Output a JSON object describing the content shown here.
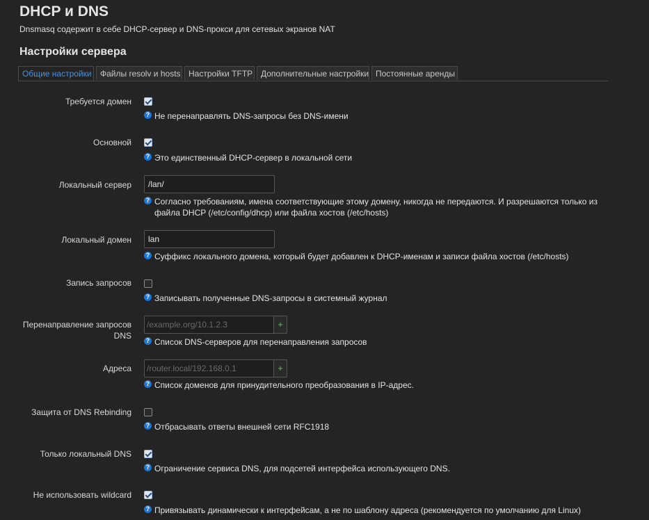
{
  "header": {
    "title": "DHCP и DNS",
    "description": "Dnsmasq содержит в себе DHCP-сервер и DNS-прокси для сетевых экранов NAT"
  },
  "section": {
    "title": "Настройки сервера"
  },
  "tabs": [
    {
      "label": "Общие настройки",
      "active": true
    },
    {
      "label": "Файлы resolv и hosts",
      "active": false
    },
    {
      "label": "Настройки TFTP",
      "active": false
    },
    {
      "label": "Дополнительные настройки",
      "active": false
    },
    {
      "label": "Постоянные аренды",
      "active": false
    }
  ],
  "fields": {
    "domain_required": {
      "label": "Требуется домен",
      "checked": true,
      "help": "Не перенаправлять DNS-запросы без DNS-имени"
    },
    "authoritative": {
      "label": "Основной",
      "checked": true,
      "help": "Это единственный DHCP-сервер в локальной сети"
    },
    "local_server": {
      "label": "Локальный сервер",
      "value": "/lan/",
      "help_line1": "Согласно требованиям, имена соответствующие этому домену, никогда не передаются. И разрешаются только из",
      "help_line2": "файла DHCP (/etc/config/dhcp) или файла хостов (/etc/hosts)"
    },
    "local_domain": {
      "label": "Локальный домен",
      "value": "lan",
      "help": "Суффикс локального домена, который будет добавлен к DHCP-именам и записи файла хостов (/etc/hosts)"
    },
    "log_queries": {
      "label": "Запись запросов",
      "checked": false,
      "help": "Записывать полученные DNS-запросы в системный журнал"
    },
    "dns_forwardings": {
      "label_line1": "Перенаправление запросов",
      "label_line2": "DNS",
      "placeholder": "/example.org/10.1.2.3",
      "add": "+",
      "help": "Список DNS-серверов для перенаправления запросов"
    },
    "addresses": {
      "label": "Адреса",
      "placeholder": "/router.local/192.168.0.1",
      "add": "+",
      "help": "Список доменов для принудительного преобразования в IP-адрес."
    },
    "rebind_protection": {
      "label": "Защита от DNS Rebinding",
      "checked": false,
      "help": "Отбрасывать ответы внешней сети RFC1918"
    },
    "localservice": {
      "label": "Только локальный DNS",
      "checked": true,
      "help": "Ограничение сервиса DNS, для подсетей интерфейса использующего DNS."
    },
    "nonwildcard": {
      "label": "Не использовать wildcard",
      "checked": true,
      "help": "Привязывать динамически к интерфейсам, а не по шаблону адреса (рекомендуется по умолчанию для Linux)"
    }
  },
  "icons": {
    "help": "help-icon",
    "help_glyph": "?",
    "check": "checkmark"
  },
  "colors": {
    "accent": "#4d8fd8",
    "help_icon": "#1e76d6",
    "background": "#242424",
    "add_button": "#5fbf5f"
  }
}
